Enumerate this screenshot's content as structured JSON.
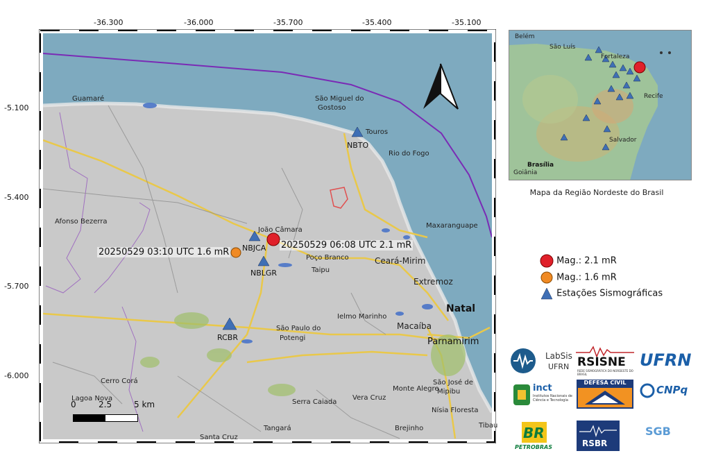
{
  "main_map": {
    "lon_ticks": [
      "-36.300",
      "-36.000",
      "-35.700",
      "-35.400",
      "-35.100"
    ],
    "lat_ticks": [
      "-5.100",
      "-5.400",
      "-5.700",
      "-6.000"
    ],
    "places": [
      {
        "name": "Guamaré"
      },
      {
        "name": "São Miguel do"
      },
      {
        "name": "Gostoso"
      },
      {
        "name": "Touros"
      },
      {
        "name": "Rio do Fogo"
      },
      {
        "name": "Afonso Bezerra"
      },
      {
        "name": "João Câmara"
      },
      {
        "name": "Maxaranguape"
      },
      {
        "name": "Poço Branco"
      },
      {
        "name": "Taipu"
      },
      {
        "name": "Ceará-Mirim"
      },
      {
        "name": "Extremoz"
      },
      {
        "name": "Natal"
      },
      {
        "name": "Ielmo Marinho"
      },
      {
        "name": "Macaíba"
      },
      {
        "name": "Parnamirim"
      },
      {
        "name": "São Paulo do"
      },
      {
        "name": "Potengi"
      },
      {
        "name": "Cerro Corá"
      },
      {
        "name": "Lagoa Nova"
      },
      {
        "name": "Monte Alegre"
      },
      {
        "name": "Vera Cruz"
      },
      {
        "name": "Serra Caiada"
      },
      {
        "name": "São José de"
      },
      {
        "name": "Mipibu"
      },
      {
        "name": "Nísia Floresta"
      },
      {
        "name": "Brejinho"
      },
      {
        "name": "Tangará"
      },
      {
        "name": "Santa Cruz"
      },
      {
        "name": "Tibau"
      }
    ],
    "stations": [
      {
        "code": "NBTO"
      },
      {
        "code": "NBJCA"
      },
      {
        "code": "NBLGR"
      },
      {
        "code": "RCBR"
      }
    ],
    "events": [
      {
        "label": "20250529 06:08 UTC 2.1 mR",
        "magnitude": 2.1,
        "color": "#e0202a"
      },
      {
        "label": "20250529 03:10 UTC 1.6 mR",
        "magnitude": 1.6,
        "color": "#f08a24"
      }
    ],
    "scale_bar": {
      "labels": [
        "0",
        "2.5",
        "5 km"
      ]
    },
    "north_arrow": "north-arrow-icon"
  },
  "inset": {
    "places": [
      "Belém",
      "São Luís",
      "Fortaleza",
      "Recife",
      "Salvador",
      "Brasília",
      "Goiânia"
    ],
    "caption": "Mapa da Região Nordeste do Brasil"
  },
  "legend": {
    "items": [
      {
        "label": "Mag.: 2.1 mR",
        "symbol": "red-circle-icon",
        "color": "#e0202a"
      },
      {
        "label": "Mag.: 1.6 mR",
        "symbol": "orange-circle-icon",
        "color": "#f08a24"
      },
      {
        "label": "Estações Sismográficas",
        "symbol": "blue-triangle-icon",
        "color": "#3f6fb5"
      }
    ]
  },
  "logos": {
    "labsis": {
      "line1": "LabSis",
      "line2": "UFRN"
    },
    "rsisne": {
      "title": "RSISNE",
      "subtitle": "REDE SISMOGRÁFICA DO NORDESTE DO BRASIL"
    },
    "ufrn": {
      "title": "UFRN"
    },
    "inct": {
      "title": "inct",
      "subtitle": "Institutos Nacionais de Ciência e Tecnologia"
    },
    "defesa": {
      "title": "DEFESA CIVIL"
    },
    "cnpq": {
      "title": "CNPq"
    },
    "petrobras": {
      "title": "BR",
      "subtitle": "PETROBRAS"
    },
    "rsbr": {
      "title": "RSBR"
    },
    "sgb": {
      "title": "SGB"
    }
  }
}
